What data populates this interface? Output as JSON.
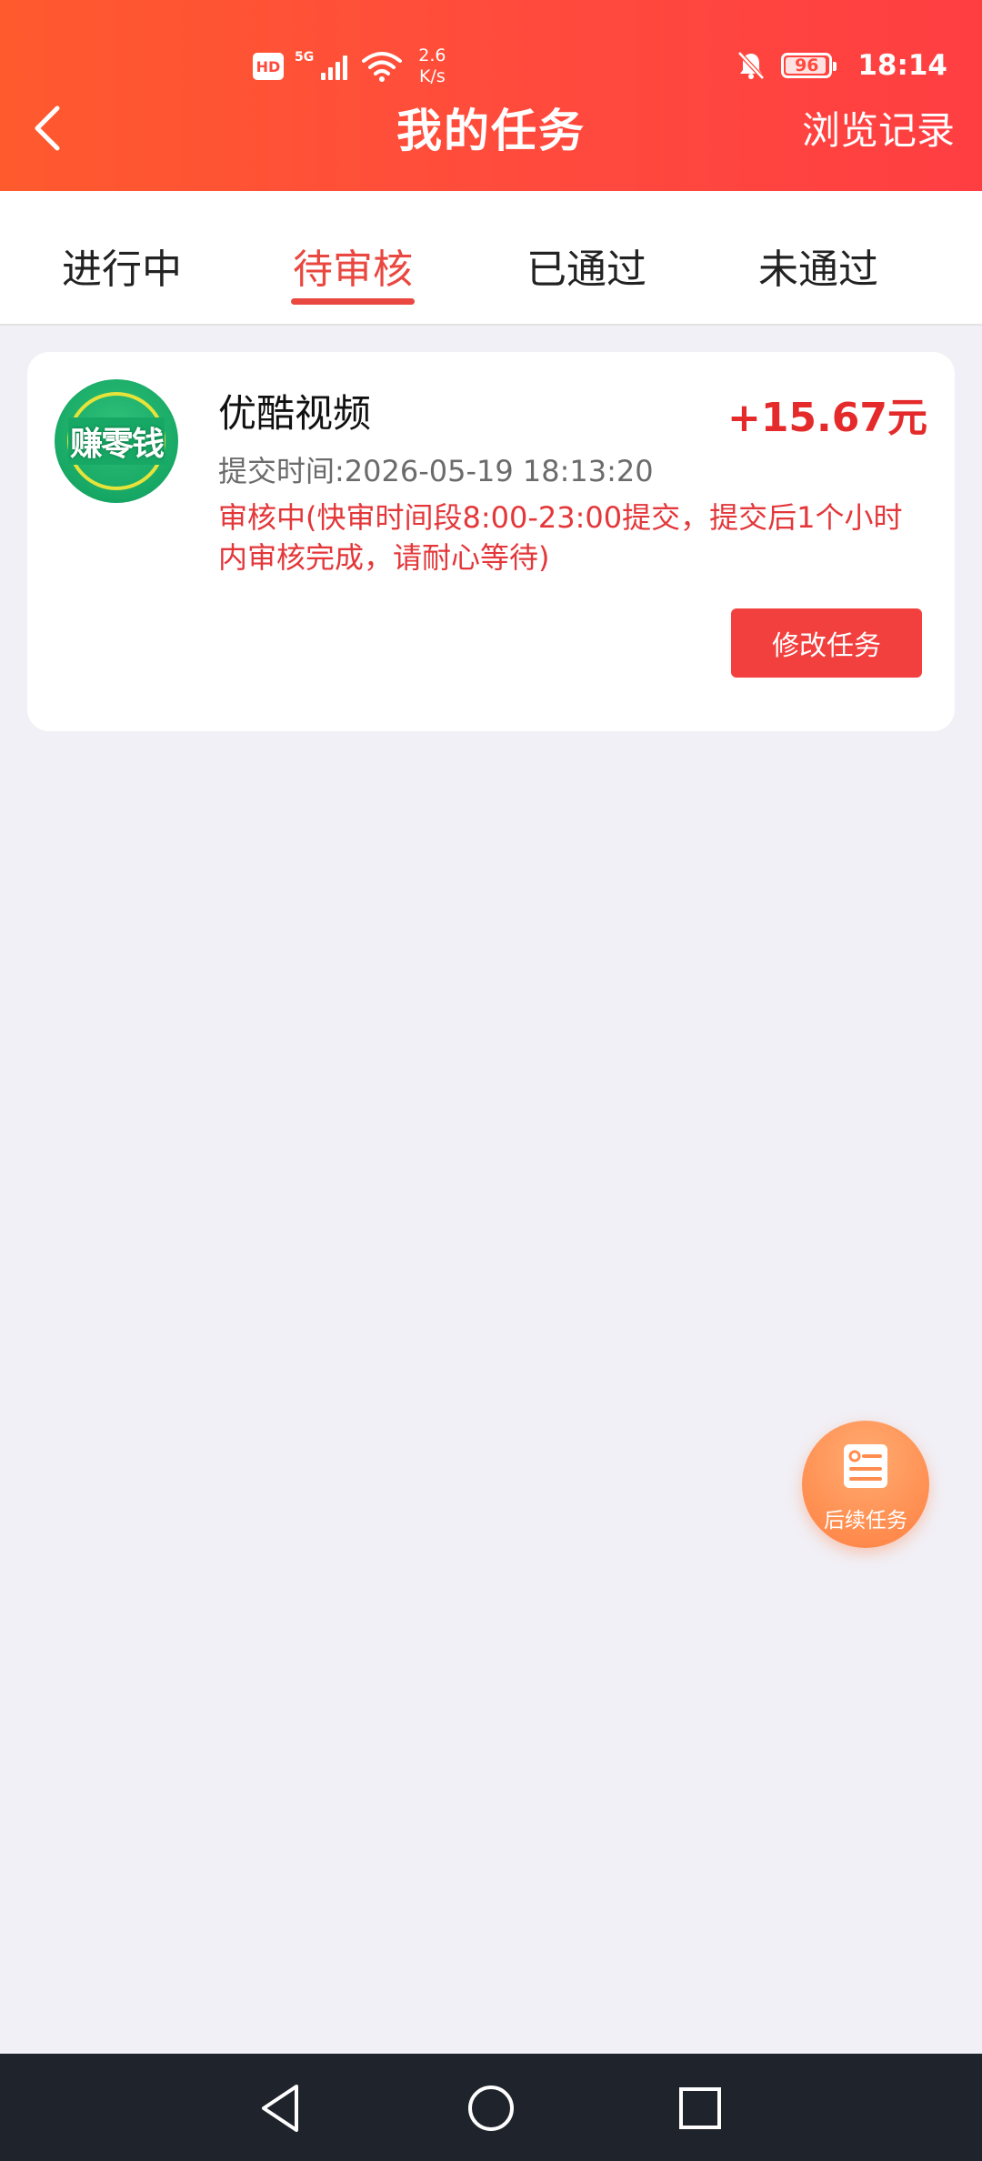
{
  "status_bar": {
    "hd_badge": "HD",
    "network_type": "5G",
    "speed_value": "2.6",
    "speed_unit": "K/s",
    "battery": "96",
    "time": "18:14"
  },
  "header": {
    "title": "我的任务",
    "history_link": "浏览记录"
  },
  "tabs": [
    {
      "label": "进行中",
      "active": false
    },
    {
      "label": "待审核",
      "active": true
    },
    {
      "label": "已通过",
      "active": false
    },
    {
      "label": "未通过",
      "active": false
    }
  ],
  "task": {
    "logo_text": "赚零钱",
    "name": "优酷视频",
    "reward": "+15.67元",
    "submit_time": "提交时间:2026-05-19 18:13:20",
    "review_note": "审核中(快审时间段8:00-23:00提交，提交后1个小时内审核完成，请耐心等待)",
    "modify_button": "修改任务"
  },
  "fab": {
    "label": "后续任务"
  },
  "colors": {
    "header_gradient_start": "#ff5a2e",
    "header_gradient_end": "#ff3e42",
    "accent_red": "#e9473f",
    "reward_red": "#e42a2a",
    "fab_orange": "#ff8d4f",
    "page_bg": "#f1f0f6",
    "nav_bar_bg": "#1f232c"
  },
  "icons": [
    "chevron-left-icon",
    "wifi-icon",
    "signal-icon",
    "bell-off-icon",
    "battery-icon",
    "task-list-icon",
    "back-triangle-icon",
    "home-circle-icon",
    "recents-square-icon"
  ]
}
